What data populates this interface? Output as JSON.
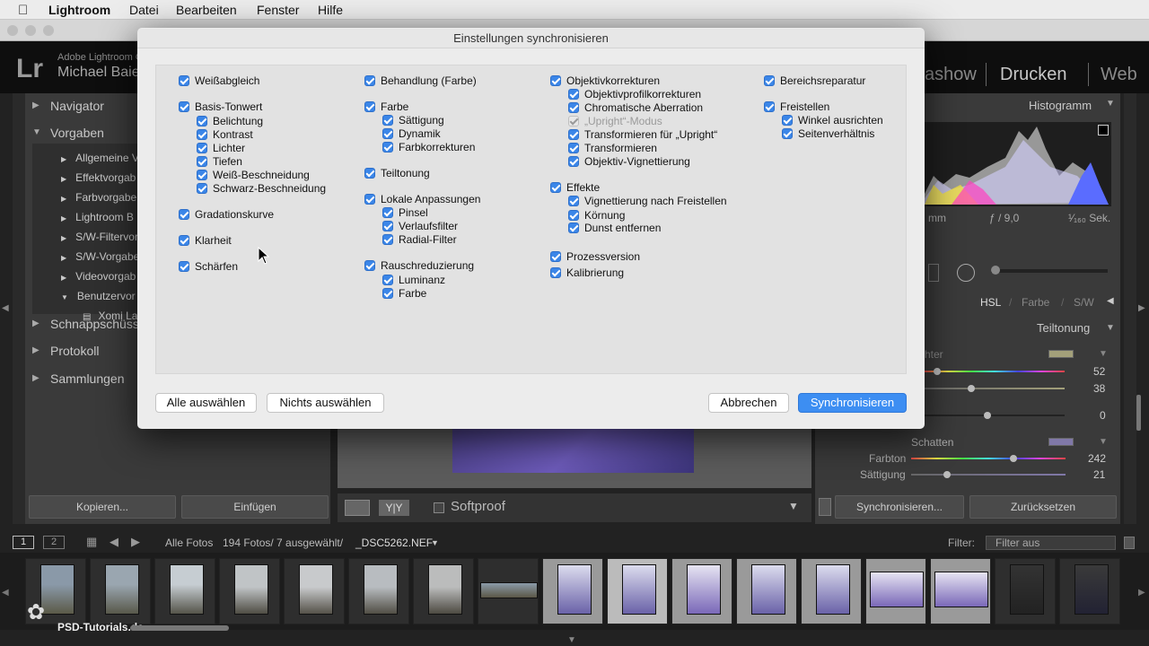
{
  "menubar": {
    "apple": "",
    "app": "Lightroom",
    "items": [
      "Datei",
      "Bearbeiten",
      "Fenster",
      "Hilfe"
    ]
  },
  "identity": {
    "logo": "Lr",
    "product": "Adobe Lightroom C",
    "user": "Michael Baie",
    "modules": [
      "ashow",
      "Drucken",
      "Web"
    ]
  },
  "left_panel": {
    "navigator": "Navigator",
    "presets": "Vorgaben",
    "preset_items": [
      "Allgemeine V",
      "Effektvorgab",
      "Farbvorgabe",
      "Lightroom B",
      "S/W-Filtervor",
      "S/W-Vorgabe",
      "Videovorgab",
      "Benutzervor"
    ],
    "user_preset": "Xomi La",
    "snapshots": "Schnappschüsse",
    "history": "Protokoll",
    "collections": "Sammlungen",
    "copy_button": "Kopieren...",
    "paste_button": "Einfügen"
  },
  "right_panel": {
    "histogram": "Histogramm",
    "exif": {
      "focal": "mm",
      "aperture": "ƒ / 9,0",
      "shutter": "¹⁄₁₆₀ Sek."
    },
    "hsl_tabs": [
      "HSL",
      "Farbe",
      "S/W"
    ],
    "split_toning": "Teiltonung",
    "highlights_label": "hter",
    "highlights_values": [
      "52",
      "38"
    ],
    "balance_value": "0",
    "shadows": "Schatten",
    "hue_label": "Farbton",
    "hue_value": "242",
    "sat_label": "Sättigung",
    "sat_value": "21",
    "sync_button": "Synchronisieren...",
    "reset_button": "Zurücksetzen"
  },
  "toolbar": {
    "softproof": "Softproof"
  },
  "filmbar": {
    "views": [
      "1",
      "2"
    ],
    "source": "Alle Fotos",
    "count": "194 Fotos/ 7 ausgewählt/",
    "file": "_DSC5262.NEF",
    "filter_label": "Filter:",
    "filter_value": "Filter aus"
  },
  "watermark": "PSD-Tutorials.de",
  "dialog": {
    "title": "Einstellungen synchronisieren",
    "col1": [
      {
        "label": "Weißabgleich",
        "indent": 0
      },
      {
        "label": "Basis-Tonwert",
        "indent": 0
      },
      {
        "label": "Belichtung",
        "indent": 1
      },
      {
        "label": "Kontrast",
        "indent": 1
      },
      {
        "label": "Lichter",
        "indent": 1
      },
      {
        "label": "Tiefen",
        "indent": 1
      },
      {
        "label": "Weiß-Beschneidung",
        "indent": 1
      },
      {
        "label": "Schwarz-Beschneidung",
        "indent": 1
      },
      {
        "label": "Gradationskurve",
        "indent": 0
      },
      {
        "label": "Klarheit",
        "indent": 0
      },
      {
        "label": "Schärfen",
        "indent": 0
      }
    ],
    "col2": [
      {
        "label": "Behandlung (Farbe)",
        "indent": 0
      },
      {
        "label": "Farbe",
        "indent": 0
      },
      {
        "label": "Sättigung",
        "indent": 1
      },
      {
        "label": "Dynamik",
        "indent": 1
      },
      {
        "label": "Farbkorrekturen",
        "indent": 1
      },
      {
        "label": "Teiltonung",
        "indent": 0
      },
      {
        "label": "Lokale Anpassungen",
        "indent": 0
      },
      {
        "label": "Pinsel",
        "indent": 1
      },
      {
        "label": "Verlaufsfilter",
        "indent": 1
      },
      {
        "label": "Radial-Filter",
        "indent": 1
      },
      {
        "label": "Rauschreduzierung",
        "indent": 0
      },
      {
        "label": "Luminanz",
        "indent": 1
      },
      {
        "label": "Farbe",
        "indent": 1
      }
    ],
    "col3": [
      {
        "label": "Objektivkorrekturen",
        "indent": 0
      },
      {
        "label": "Objektivprofilkorrekturen",
        "indent": 1
      },
      {
        "label": "Chromatische Aberration",
        "indent": 1
      },
      {
        "label": "„Upright“-Modus",
        "indent": 1,
        "disabled": true
      },
      {
        "label": "Transformieren für „Upright“",
        "indent": 1
      },
      {
        "label": "Transformieren",
        "indent": 1
      },
      {
        "label": "Objektiv-Vignettierung",
        "indent": 1
      },
      {
        "label": "Effekte",
        "indent": 0
      },
      {
        "label": "Vignettierung nach Freistellen",
        "indent": 1
      },
      {
        "label": "Körnung",
        "indent": 1
      },
      {
        "label": "Dunst entfernen",
        "indent": 1
      },
      {
        "label": "Prozessversion",
        "indent": 0
      },
      {
        "label": "Kalibrierung",
        "indent": 0
      }
    ],
    "col4": [
      {
        "label": "Bereichsreparatur",
        "indent": 0
      },
      {
        "label": "Freistellen",
        "indent": 0
      },
      {
        "label": "Winkel ausrichten",
        "indent": 1
      },
      {
        "label": "Seitenverhältnis",
        "indent": 1
      }
    ],
    "select_all": "Alle auswählen",
    "select_none": "Nichts auswählen",
    "cancel": "Abbrechen",
    "synchronize": "Synchronisieren"
  },
  "colors": {
    "accent": "#3b86e8",
    "primary_button": "#3d8ef2"
  }
}
